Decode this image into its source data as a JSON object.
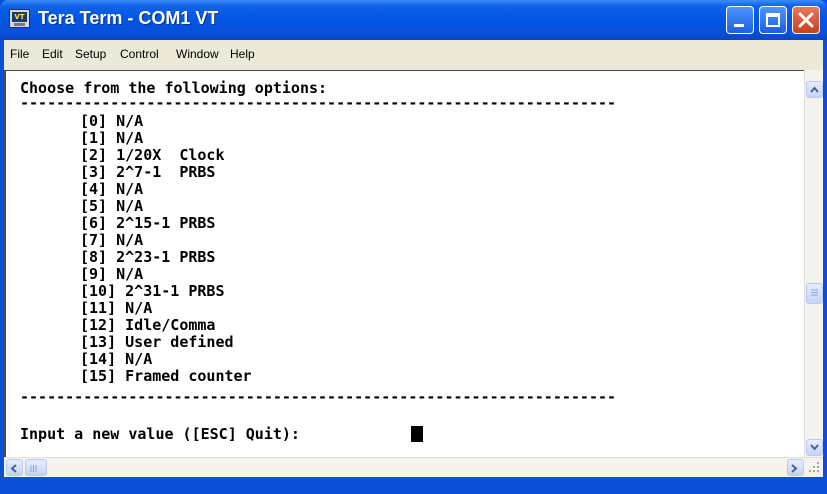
{
  "window": {
    "title": "Tera Term - COM1 VT",
    "icon_text": "VT",
    "icon": "teraterm-app-icon",
    "controls": [
      "minimize-icon",
      "maximize-icon",
      "close-icon"
    ]
  },
  "menu": {
    "items": [
      "File",
      "Edit",
      "Setup",
      "Control",
      "Window",
      "Help"
    ]
  },
  "terminal": {
    "header": "Choose from the following options:",
    "divider": "------------------------------------------------------------------",
    "options": [
      "[0] N/A",
      "[1] N/A",
      "[2] 1/20X  Clock",
      "[3] 2^7-1  PRBS",
      "[4] N/A",
      "[5] N/A",
      "[6] 2^15-1 PRBS",
      "[7] N/A",
      "[8] 2^23-1 PRBS",
      "[9] N/A",
      "[10] 2^31-1 PRBS",
      "[11] N/A",
      "[12] Idle/Comma",
      "[13] User defined",
      "[14] N/A",
      "[15] Framed counter"
    ],
    "prompt": "Input a new value ([ESC] Quit): "
  },
  "colors": {
    "title_bar": "#0055e5",
    "menu_bg": "#ece9d8",
    "terminal_bg": "#ffffff",
    "terminal_text": "#000000",
    "close_button": "#c7401f"
  }
}
